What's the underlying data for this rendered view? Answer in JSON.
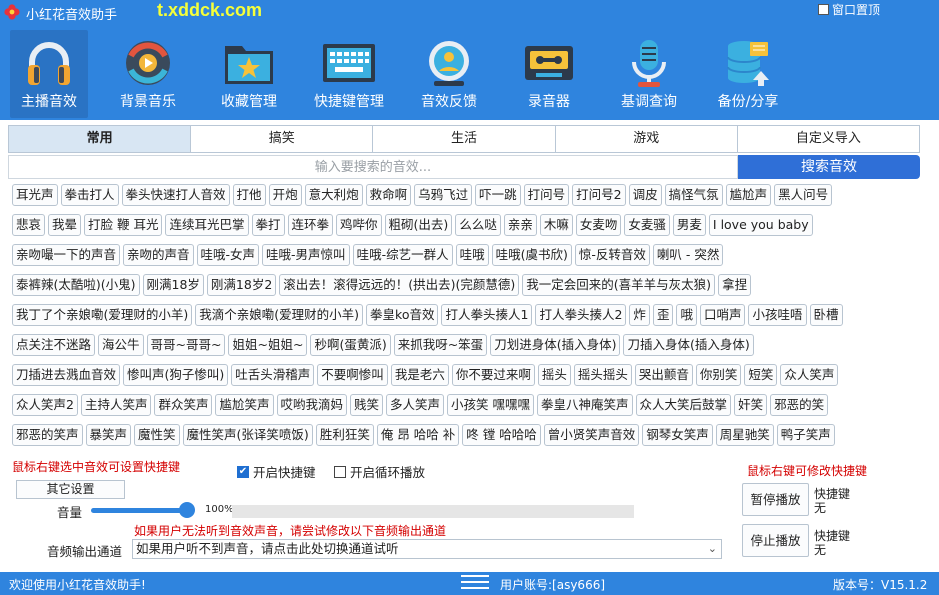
{
  "window": {
    "title": "小红花音效助手",
    "watermark": "t.xddck.com",
    "pin_label": "窗口置顶"
  },
  "toolbar": [
    {
      "label": "主播音效",
      "icon": "headphones-icon",
      "active": true
    },
    {
      "label": "背景音乐",
      "icon": "music-disc-icon",
      "active": false
    },
    {
      "label": "收藏管理",
      "icon": "star-folder-icon",
      "active": false
    },
    {
      "label": "快捷键管理",
      "icon": "keyboard-icon",
      "active": false
    },
    {
      "label": "音效反馈",
      "icon": "feedback-icon",
      "active": false
    },
    {
      "label": "录音器",
      "icon": "cassette-icon",
      "active": false
    },
    {
      "label": "基调查询",
      "icon": "microphone-icon",
      "active": false
    },
    {
      "label": "备份/分享",
      "icon": "database-backup-icon",
      "active": false
    }
  ],
  "tabs": [
    {
      "label": "常用",
      "active": true
    },
    {
      "label": "搞笑",
      "active": false
    },
    {
      "label": "生活",
      "active": false
    },
    {
      "label": "游戏",
      "active": false
    },
    {
      "label": "自定义导入",
      "active": false
    }
  ],
  "search": {
    "placeholder": "输入要搜索的音效...",
    "button_label": "搜索音效"
  },
  "sounds": [
    [
      "耳光声",
      "拳击打人",
      "拳头快速打人音效",
      "打他",
      "开炮",
      "意大利炮",
      "救命啊",
      "乌鸦飞过",
      "吓一跳",
      "打问号",
      "打问号2",
      "调皮",
      "搞怪气氛",
      "尴尬声",
      "黑人问号"
    ],
    [
      "悲哀",
      "我晕",
      "打脸 鞭 耳光",
      "连续耳光巴掌",
      "拳打",
      "连环拳",
      "鸡哔你",
      "粗砌(出去)",
      "么么哒",
      "亲亲",
      "木嘛",
      "女麦吻",
      "女麦骚",
      "男麦",
      "I love you baby"
    ],
    [
      "亲吻嘬一下的声音",
      "亲吻的声音",
      "哇哦-女声",
      "哇哦-男声惊叫",
      "哇哦-综艺一群人",
      "哇哦",
      "哇哦(虞书欣)",
      "惊-反转音效",
      "喇叭 - 突然"
    ],
    [
      "泰裤辣(太酷啦)(小鬼)",
      "刚满18岁",
      "刚满18岁2",
      "滚出去！滚得远远的！(拱出去)(完颜慧德)",
      "我一定会回来的(喜羊羊与灰太狼)",
      "拿捏"
    ],
    [
      "我丁了个亲娘嘞(爱理财的小羊)",
      "我滴个亲娘嘞(爱理财的小羊)",
      "拳皇ko音效",
      "打人拳头揍人1",
      "打人拳头揍人2",
      "炸",
      "歪",
      "哦",
      "口哨声",
      "小孩哇唔",
      "卧槽"
    ],
    [
      "点关注不迷路",
      "海公牛",
      "哥哥~哥哥~",
      "姐姐~姐姐~",
      "秒啊(蛋黄派)",
      "来抓我呀~笨蛋",
      "刀划进身体(插入身体)",
      "刀插入身体(插入身体)"
    ],
    [
      "刀插进去溅血音效",
      "惨叫声(狗子惨叫)",
      "吐舌头滑稽声",
      "不要啊惨叫",
      "我是老六",
      "你不要过来啊",
      "摇头",
      "摇头摇头",
      "哭出颤音",
      "你别笑",
      "短笑",
      "众人笑声"
    ],
    [
      "众人笑声2",
      "主持人笑声",
      "群众笑声",
      "尴尬笑声",
      "哎哟我滴妈",
      "贱笑",
      "多人笑声",
      "小孩笑 嘿嘿嘿",
      "拳皇八神庵笑声",
      "众人大笑后鼓掌",
      "奸笑",
      "邪恶的笑"
    ],
    [
      "邪恶的笑声",
      "暴笑声",
      "魔性笑",
      "魔性笑声(张译笑喷饭)",
      "胜利狂笑",
      "俺 昂 哈哈 补",
      "咚 镗 哈哈哈",
      "曾小贤笑声音效",
      "钢琴女笑声",
      "周星驰笑",
      "鸭子笑声"
    ]
  ],
  "controls": {
    "hint_left": "鼠标右键选中音效可设置快捷键",
    "enable_hotkey": "开启快捷键",
    "enable_hotkey_checked": true,
    "loop_play": "开启循环播放",
    "loop_play_checked": false,
    "hint_right": "鼠标右键可修改快捷键",
    "other_settings": "其它设置",
    "volume_label": "音量",
    "volume_value": "100%",
    "volume_fraction": 1.0,
    "output_hint": "如果用户无法听到音效声音，请尝试修改以下音频输出通道",
    "output_label": "音频输出通道",
    "output_value": "如果用户听不到声音，请点击此处切换通道试听",
    "pause_button": "暂停播放",
    "stop_button": "停止播放",
    "pause_hotkey_label": "快捷键",
    "pause_hotkey_value": "无",
    "stop_hotkey_label": "快捷键",
    "stop_hotkey_value": "无"
  },
  "status": {
    "welcome": "欢迎使用小红花音效助手!",
    "account": "用户账号:[asy666]",
    "version": "版本号：V15.1.2"
  },
  "colors": {
    "primary": "#2f84de",
    "search_button": "#2f6fd7",
    "hint_red": "#d40000"
  }
}
